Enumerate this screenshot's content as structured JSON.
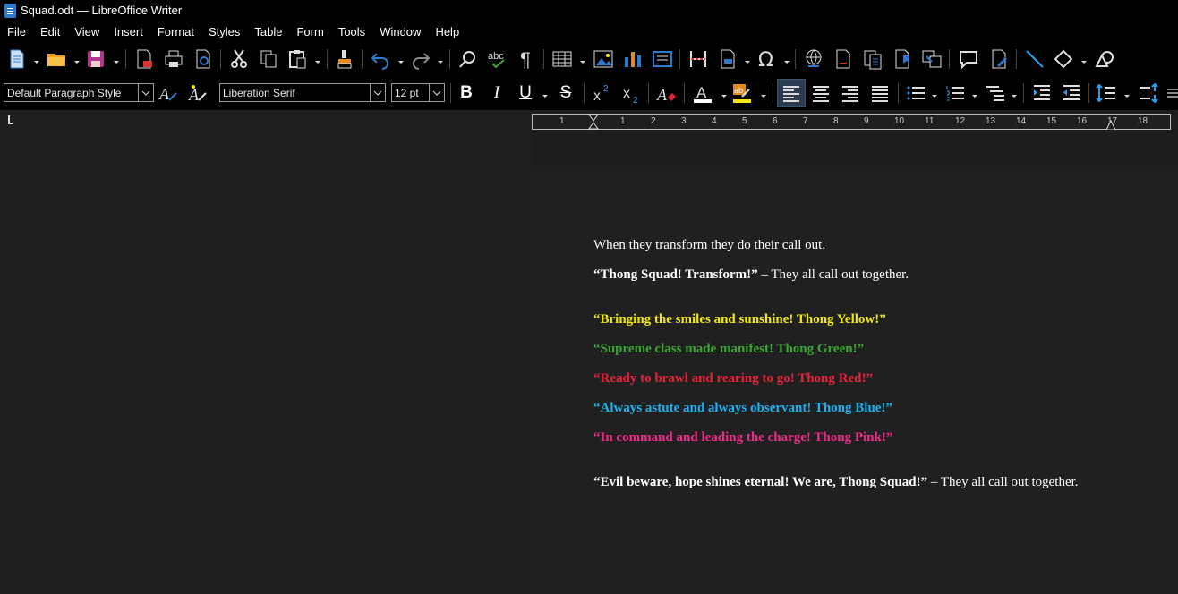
{
  "window": {
    "title": "Squad.odt — LibreOffice Writer"
  },
  "menu": [
    "File",
    "Edit",
    "View",
    "Insert",
    "Format",
    "Styles",
    "Table",
    "Form",
    "Tools",
    "Window",
    "Help"
  ],
  "toolbar": {
    "paragraph_style": "Default Paragraph Style",
    "font_name": "Liberation Serif",
    "font_size": "12 pt"
  },
  "ruler": {
    "labels": [
      "1",
      "1",
      "2",
      "3",
      "4",
      "5",
      "6",
      "7",
      "8",
      "9",
      "10",
      "11",
      "12",
      "13",
      "14",
      "15",
      "16",
      "17",
      "18"
    ]
  },
  "document": {
    "lines": [
      {
        "parts": [
          {
            "text": "When they transform they do their call out.",
            "style": "white"
          }
        ]
      },
      {
        "parts": [
          {
            "text": "“Thong Squad! Transform!”",
            "style": "white bold"
          },
          {
            "text": " – They all call out together.",
            "style": "white"
          }
        ]
      },
      {
        "parts": [
          {
            "text": "“Bringing the smiles and sunshine! Thong Yellow!”",
            "style": "yellow bold"
          }
        ]
      },
      {
        "parts": [
          {
            "text": "“Supreme class made manifest! Thong Green!”",
            "style": "green bold"
          }
        ]
      },
      {
        "parts": [
          {
            "text": "“Ready to brawl and rearing to go! Thong Red!”",
            "style": "red bold"
          }
        ]
      },
      {
        "parts": [
          {
            "text": "“Always astute and always observant! Thong Blue!”",
            "style": "blue bold"
          }
        ]
      },
      {
        "parts": [
          {
            "text": "“In command and leading the charge! Thong Pink!”",
            "style": "pink bold"
          }
        ]
      },
      {
        "parts": [
          {
            "text": "“Evil beware, hope shines eternal! We are, Thong Squad!”",
            "style": "white bold"
          },
          {
            "text": " – They all call out together.",
            "style": "white"
          }
        ]
      }
    ]
  },
  "colors": {
    "yellow": "#f3e80a",
    "green": "#3aa535",
    "red": "#e8213a",
    "blue": "#1ab2f4",
    "pink": "#f02a8a",
    "accent": "#2a7bd0"
  }
}
